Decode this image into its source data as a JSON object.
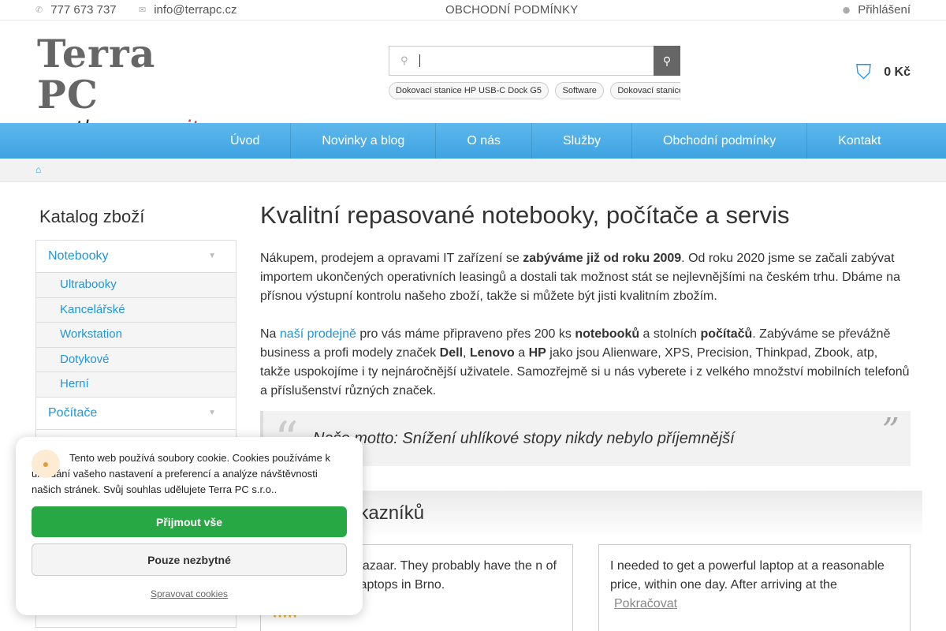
{
  "topbar": {
    "phone": "777 673 737",
    "email": "info@terrapc.cz",
    "terms": "OBCHODNÍ PODMÍNKY",
    "login": "Přihlášení"
  },
  "logo": {
    "line1": "Terra PC",
    "line2_a": "...the green ",
    "line2_b": "it"
  },
  "search": {
    "value": "",
    "suggestions": [
      "Dokovací stanice HP USB-C Dock G5",
      "Software",
      "Dokovací stanice"
    ]
  },
  "cart": {
    "price": "0 Kč"
  },
  "nav": [
    "Úvod",
    "Novinky a blog",
    "O nás",
    "Služby",
    "Obchodní podmínky",
    "Kontakt"
  ],
  "sidebar": {
    "title": "Katalog zboží",
    "categories": [
      {
        "label": "Notebooky",
        "children": [
          "Ultrabooky",
          "Kancelářské",
          "Workstation",
          "Dotykové",
          "Herní"
        ]
      },
      {
        "label": "Počítače"
      }
    ]
  },
  "main": {
    "title": "Kvalitní repasované notebooky, počítače a servis",
    "p1_a": "Nákupem, prodejem a opravami IT zařízení se ",
    "p1_b": "zabýváme již od roku 2009",
    "p1_c": ". Od roku 2020 jsme se začali zabývat importem ukončených operativních leasingů a dostali tak možnost stát se nejlevnějšími na českém trhu. Dbáme na přísnou výstupní kontrolu našeho zboží, takže si můžete být jisti kvalitním zbožím.",
    "p2_a": "Na ",
    "p2_link": "naší prodejně",
    "p2_b": " pro vás máme připraveno přes 200 ks ",
    "p2_bold1": "notebooků",
    "p2_c": " a stolních ",
    "p2_bold2": "počítačů",
    "p2_d": ". Zabýváme se převážně business a profi modely značek ",
    "p2_dell": "Dell",
    "p2_comma": ", ",
    "p2_lenovo": "Lenovo",
    "p2_and": " a ",
    "p2_hp": "HP",
    "p2_e": " jako jsou Alienware, XPS, Precision, Thinkpad, Zbook, atp, takže uspokojíme i ty nejnáročnější uživatele. Samozřejmě si u nás vyberete i z velkého množství mobilních telefonů a příslušenství různých značek.",
    "motto": "Naše motto: Snížení uhlíkové stopy nikdy nebylo příjemnější",
    "reviews_title": "zákazníků",
    "review1": "bazaar. They probably have the n of laptops in Brno.",
    "review2": "I needed to get a powerful laptop at a reasonable price, within one day. After arriving at the",
    "review_more": "Pokračovat"
  },
  "cookie": {
    "text": "Tento web používá soubory cookie. Cookies používáme k ukládání vašeho nastavení a preferencí a analýze návštěvnosti našich stránek. Svůj souhlas udělujete Terra PC s.r.o..",
    "accept": "Přijmout vše",
    "necessary": "Pouze nezbytné",
    "manage": "Spravovat cookies"
  }
}
